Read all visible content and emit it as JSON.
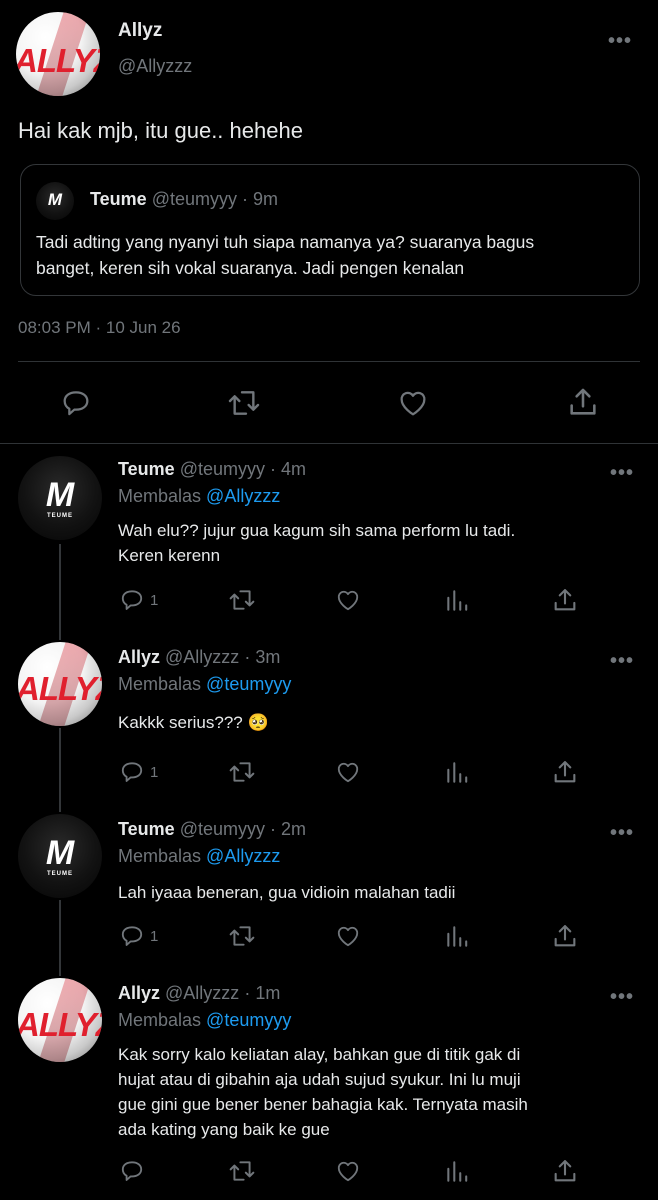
{
  "main_tweet": {
    "name": "Allyz",
    "handle": "@Allyzzz",
    "avatar_text": "ALLYZ",
    "text": "Hai kak mjb, itu gue.. hehehe",
    "timestamp": "08:03 PM · 10 Jun 26",
    "more": "•••"
  },
  "quoted_tweet": {
    "name": "Teume",
    "handle": "@teumyyy",
    "time": "· 9m",
    "avatar_text": "M",
    "text_line1": "Tadi adting yang nyanyi tuh siapa namanya ya? suaranya bagus",
    "text_line2": "banget, keren sih vokal suaranya. Jadi pengen kenalan"
  },
  "replies": [
    {
      "name": "Teume",
      "handle": "@teumyyy",
      "time": "· 4m",
      "replying_prefix": "Membalas",
      "replying_to": "@Allyzzz",
      "line1": "Wah elu?? jujur gua kagum sih sama perform lu tadi.",
      "line2": "Keren kerenn",
      "reply_count": "1",
      "avatar_m": "M",
      "avatar_label": "TEUME"
    },
    {
      "name": "Allyz",
      "handle": "@Allyzzz",
      "time": "· 3m",
      "replying_prefix": "Membalas",
      "replying_to": "@teumyyy",
      "line1": "Kakkk serius??? 🥺",
      "reply_count": "1",
      "avatar_text": "ALLYZ"
    },
    {
      "name": "Teume",
      "handle": "@teumyyy",
      "time": "· 2m",
      "replying_prefix": "Membalas",
      "replying_to": "@Allyzzz",
      "line1": "Lah iyaaa beneran, gua vidioin malahan tadii",
      "reply_count": "1",
      "avatar_m": "M",
      "avatar_label": "TEUME"
    },
    {
      "name": "Allyz",
      "handle": "@Allyzzz",
      "time": "· 1m",
      "replying_prefix": "Membalas",
      "replying_to": "@teumyyy",
      "line1": "Kak sorry kalo keliatan alay, bahkan gue di titik gak di",
      "line2": "hujat atau di gibahin aja udah sujud syukur. Ini lu muji",
      "line3": "gue gini gue bener bener bahagia kak. Ternyata masih",
      "line4": "ada kating yang baik ke gue",
      "avatar_text": "ALLYZ"
    }
  ],
  "icons": {
    "reply": "reply-icon",
    "retweet": "retweet-icon",
    "like": "heart-icon",
    "views": "views-icon",
    "share": "share-icon",
    "more": "more-icon"
  },
  "colors": {
    "background": "#000000",
    "text": "#e7e9ea",
    "muted": "#71767b",
    "link": "#1d9bf0",
    "divider": "#2f3336",
    "brand_red": "#e0202e"
  }
}
